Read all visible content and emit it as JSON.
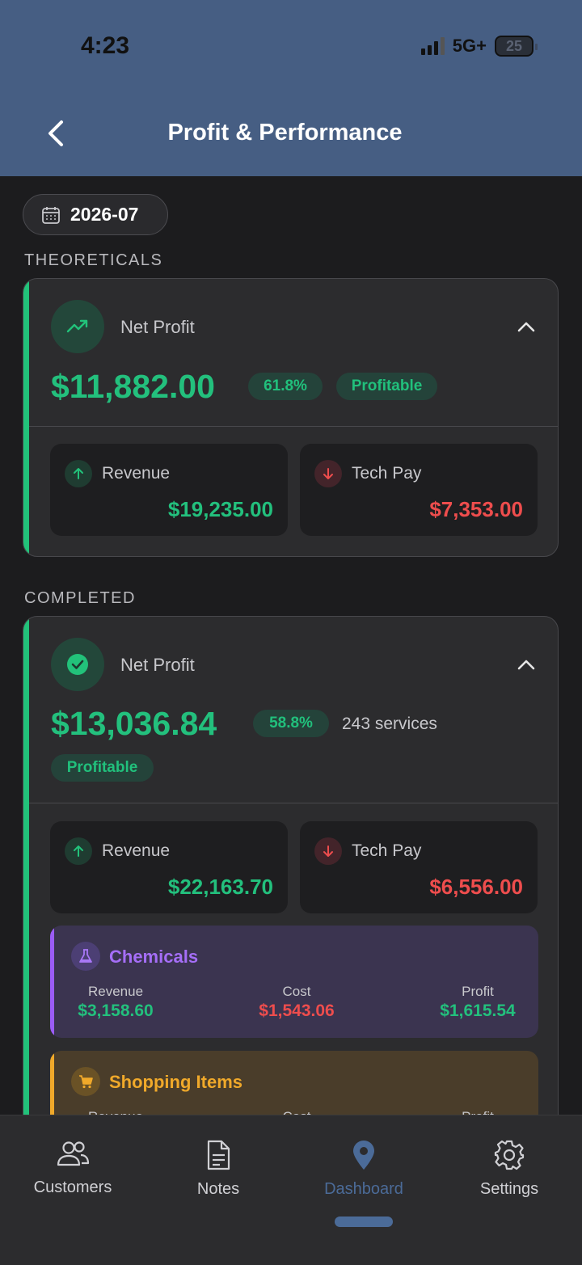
{
  "status_bar": {
    "time": "4:23",
    "network": "5G+",
    "battery": "25"
  },
  "header": {
    "title": "Profit & Performance"
  },
  "date_filter": {
    "value": "2026-07"
  },
  "theoreticals": {
    "section_label": "THEORETICALS",
    "title": "Net Profit",
    "amount": "$11,882.00",
    "margin": "61.8%",
    "status": "Profitable",
    "revenue_label": "Revenue",
    "revenue_value": "$19,235.00",
    "techpay_label": "Tech Pay",
    "techpay_value": "$7,353.00"
  },
  "completed": {
    "section_label": "COMPLETED",
    "title": "Net Profit",
    "amount": "$13,036.84",
    "margin": "58.8%",
    "services": "243 services",
    "status": "Profitable",
    "revenue_label": "Revenue",
    "revenue_value": "$22,163.70",
    "techpay_label": "Tech Pay",
    "techpay_value": "$6,556.00",
    "chemicals": {
      "title": "Chemicals",
      "revenue_label": "Revenue",
      "revenue": "$3,158.60",
      "cost_label": "Cost",
      "cost": "$1,543.06",
      "profit_label": "Profit",
      "profit": "$1,615.54"
    },
    "shopping": {
      "title": "Shopping Items",
      "revenue_label": "Revenue",
      "cost_label": "Cost",
      "profit_label": "Profit"
    }
  },
  "tabs": [
    {
      "label": "Customers",
      "icon": "customers-icon"
    },
    {
      "label": "Notes",
      "icon": "notes-icon"
    },
    {
      "label": "Dashboard",
      "icon": "dashboard-icon",
      "active": true
    },
    {
      "label": "Settings",
      "icon": "settings-icon"
    }
  ],
  "colors": {
    "accent": "#22c27a",
    "negative": "#ee4d4d",
    "header": "#465e83",
    "active_tab": "#4b6b98"
  }
}
